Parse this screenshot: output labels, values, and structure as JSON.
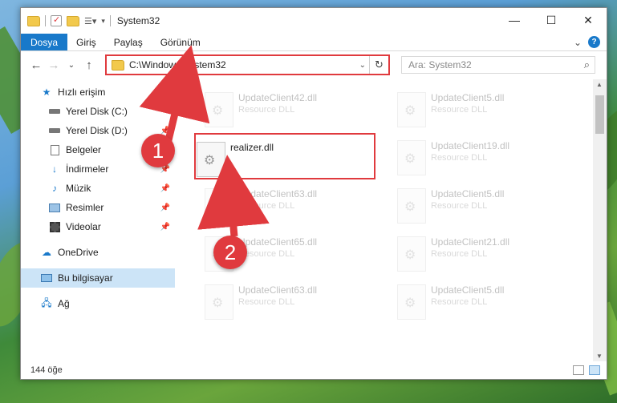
{
  "window": {
    "title": "System32",
    "controls": {
      "minimize": "—",
      "maximize": "☐",
      "close": "✕"
    }
  },
  "ribbon": {
    "tabs": [
      "Dosya",
      "Giriş",
      "Paylaş",
      "Görünüm"
    ],
    "expand": "⌄",
    "help": "?"
  },
  "navigation": {
    "back": "←",
    "forward": "→",
    "recent": "⌄",
    "up": "↑"
  },
  "address": {
    "path": "C:\\Windows\\System32",
    "dropdown": "⌄",
    "refresh": "↻"
  },
  "search": {
    "placeholder": "Ara: System32",
    "icon": "search-icon"
  },
  "sidebar": {
    "quick_access": "Hızlı erişim",
    "items": [
      {
        "label": "Yerel Disk (C:)",
        "icon": "drive-icon",
        "pinned": true
      },
      {
        "label": "Yerel Disk (D:)",
        "icon": "drive-icon",
        "pinned": true
      },
      {
        "label": "Belgeler",
        "icon": "documents-icon",
        "pinned": true
      },
      {
        "label": "İndirmeler",
        "icon": "downloads-icon",
        "pinned": true
      },
      {
        "label": "Müzik",
        "icon": "music-icon",
        "pinned": true
      },
      {
        "label": "Resimler",
        "icon": "pictures-icon",
        "pinned": true
      },
      {
        "label": "Videolar",
        "icon": "videos-icon",
        "pinned": true
      }
    ],
    "onedrive": "OneDrive",
    "this_pc": "Bu bilgisayar",
    "network": "Ağ"
  },
  "files": {
    "highlighted": {
      "name": "realizer.dll",
      "type": ""
    },
    "left_column": [
      {
        "name": "UpdateClient42.dll",
        "type": "Resource DLL"
      },
      {
        "name": "UpdateClient63.dll",
        "type": "Resource DLL"
      },
      {
        "name": "UpdateClient65.dll",
        "type": "Resource DLL"
      },
      {
        "name": "UpdateClient63.dll",
        "type": "Resource DLL"
      }
    ],
    "right_column": [
      {
        "name": "UpdateClient5.dll",
        "type": "Resource DLL"
      },
      {
        "name": "UpdateClient19.dll",
        "type": "Resource DLL"
      },
      {
        "name": "UpdateClient5.dll",
        "type": "Resource DLL"
      },
      {
        "name": "UpdateClient21.dll",
        "type": "Resource DLL"
      },
      {
        "name": "UpdateClient5.dll",
        "type": "Resource DLL"
      }
    ]
  },
  "status": {
    "count": "144 öğe"
  },
  "annotations": {
    "step1": "1",
    "step2": "2",
    "color": "#e03a3e"
  },
  "colors": {
    "accent": "#1979ca",
    "selection": "#cce4f7",
    "highlight": "#e03a3e"
  }
}
